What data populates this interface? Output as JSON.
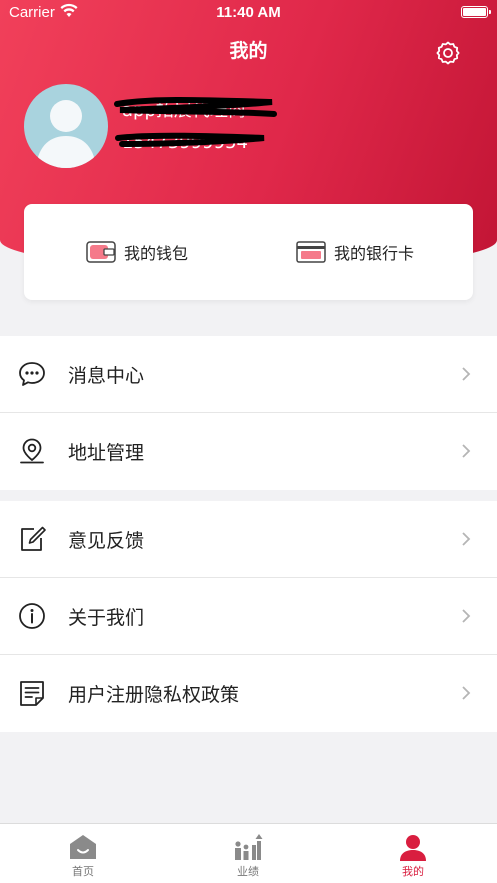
{
  "status_bar": {
    "carrier": "Carrier",
    "time": "11:40 AM"
  },
  "header": {
    "title": "我的"
  },
  "profile": {
    "name": "app拓展代理商",
    "phone": "15473999954"
  },
  "wallet_card": {
    "wallet_label": "我的钱包",
    "bank_card_label": "我的银行卡"
  },
  "menu_group_1": [
    {
      "label": "消息中心",
      "icon": "chat-bubble-icon"
    },
    {
      "label": "地址管理",
      "icon": "location-pin-icon"
    }
  ],
  "menu_group_2": [
    {
      "label": "意见反馈",
      "icon": "edit-icon"
    },
    {
      "label": "关于我们",
      "icon": "info-icon"
    },
    {
      "label": "用户注册隐私权政策",
      "icon": "document-icon"
    }
  ],
  "tabbar": {
    "tabs": [
      {
        "label": "首页",
        "icon": "home-icon"
      },
      {
        "label": "业绩",
        "icon": "performance-icon"
      },
      {
        "label": "我的",
        "icon": "user-icon"
      }
    ],
    "active_index": 2
  },
  "colors": {
    "accent": "#d91e3f",
    "header_start": "#f1405a",
    "header_end": "#c21535"
  }
}
